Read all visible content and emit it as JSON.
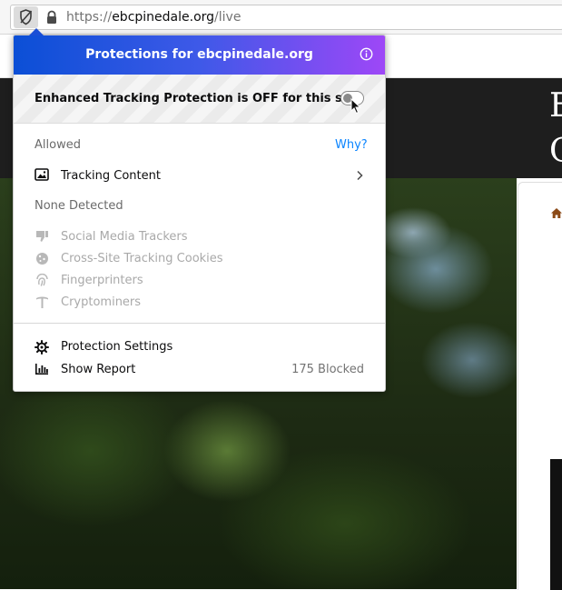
{
  "urlbar": {
    "url_scheme": "https://",
    "url_domain": "ebcpinedale.org",
    "url_path": "/live"
  },
  "background_page": {
    "letters": [
      "E",
      "C"
    ]
  },
  "panel": {
    "title": "Protections for ebcpinedale.org",
    "etp_status": "Enhanced Tracking Protection is OFF for this site",
    "etp_enabled": false,
    "allowed_label": "Allowed",
    "why_link": "Why?",
    "allowed_items": [
      {
        "label": "Tracking Content",
        "icon": "image-icon"
      }
    ],
    "none_detected_label": "None Detected",
    "none_detected_items": [
      {
        "label": "Social Media Trackers",
        "icon": "thumbs-down-icon"
      },
      {
        "label": "Cross-Site Tracking Cookies",
        "icon": "cookie-icon"
      },
      {
        "label": "Fingerprinters",
        "icon": "fingerprint-icon"
      },
      {
        "label": "Cryptominers",
        "icon": "pickaxe-icon"
      }
    ],
    "protection_settings": "Protection Settings",
    "show_report": "Show Report",
    "blocked_count": "175 Blocked"
  },
  "colors": {
    "header_gradient_start": "#0b4fd6",
    "header_gradient_end": "#9e47f7",
    "link": "#0a84ff"
  }
}
